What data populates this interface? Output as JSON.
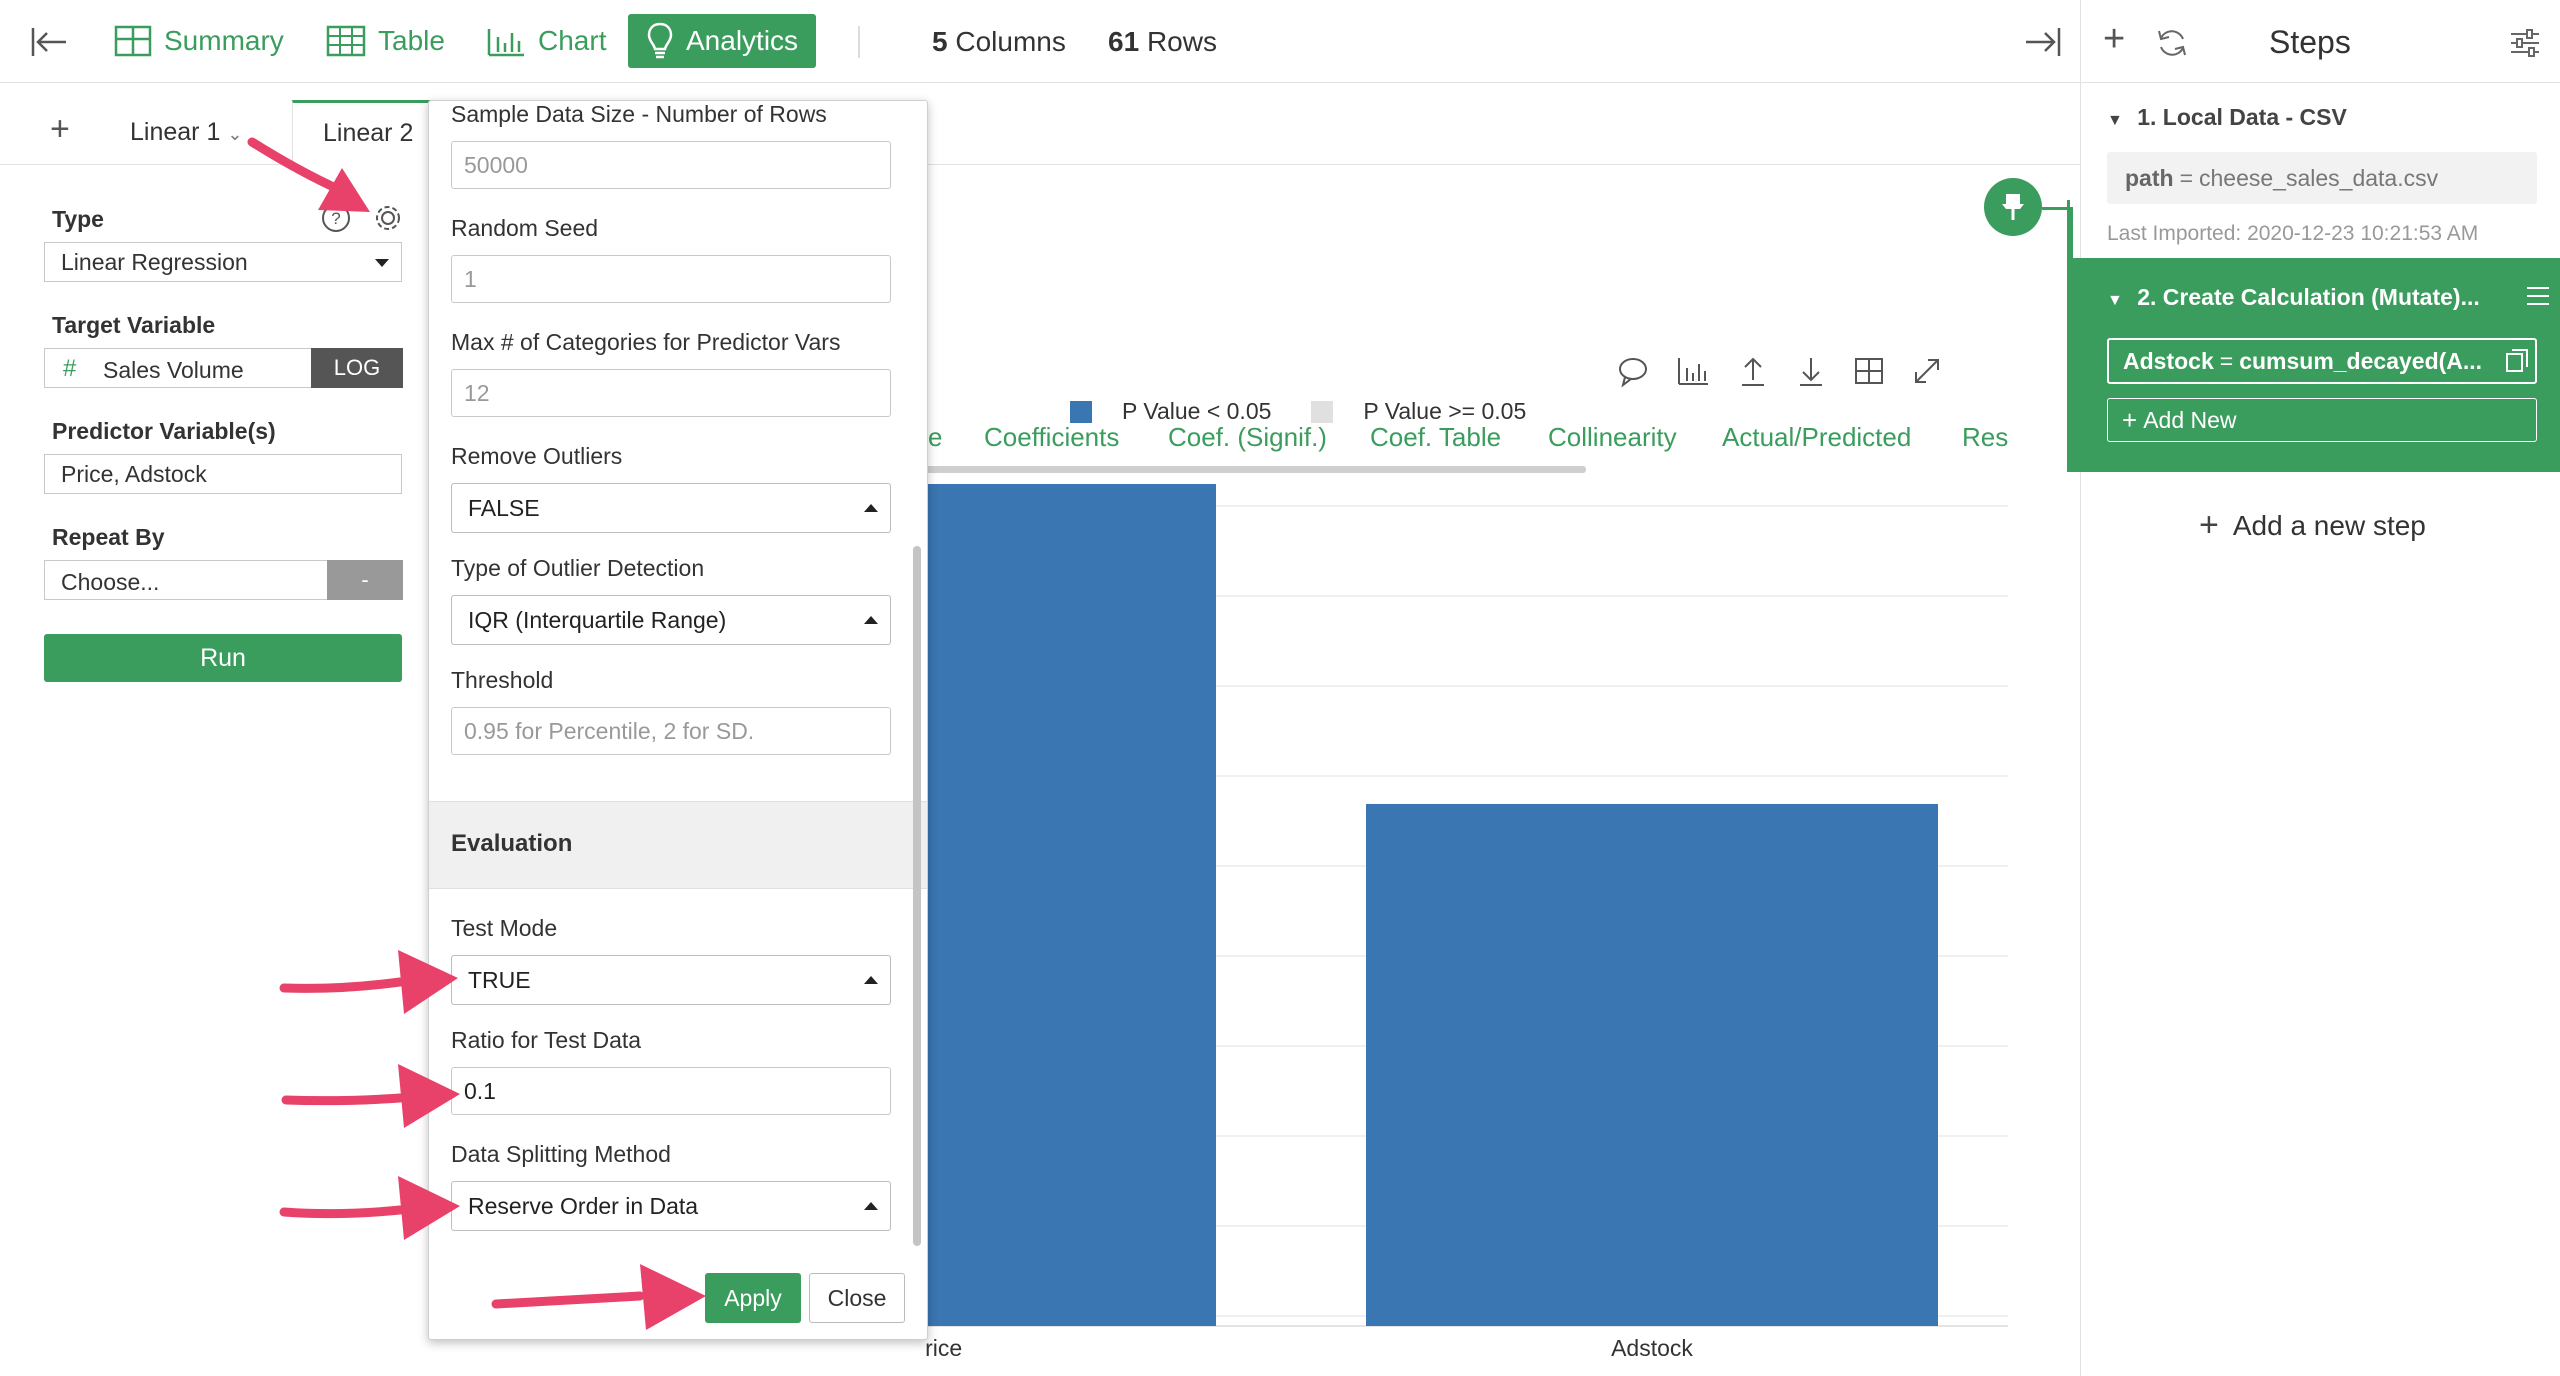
{
  "topbar": {
    "summary_label": "Summary",
    "table_label": "Table",
    "chart_label": "Chart",
    "analytics_label": "Analytics",
    "columns_count": "5",
    "columns_label": "Columns",
    "rows_count": "61",
    "rows_label": "Rows"
  },
  "tabs": {
    "add": "+",
    "items": [
      {
        "label": "Linear 1"
      },
      {
        "label": "Linear 2"
      }
    ]
  },
  "config": {
    "type_label": "Type",
    "type_value": "Linear Regression",
    "target_label": "Target Variable",
    "target_value": "Sales Volume",
    "target_badge": "LOG",
    "target_icon": "#",
    "predictor_label": "Predictor Variable(s)",
    "predictor_value": "Price, Adstock",
    "repeat_label": "Repeat By",
    "repeat_value": "Choose...",
    "repeat_badge": "-",
    "run_label": "Run"
  },
  "popup": {
    "sample_label": "Sample Data Size - Number of Rows",
    "sample_placeholder": "50000",
    "seed_label": "Random Seed",
    "seed_placeholder": "1",
    "maxcat_label": "Max # of Categories for Predictor Vars",
    "maxcat_placeholder": "12",
    "outliers_label": "Remove Outliers",
    "outliers_value": "FALSE",
    "outlier_type_label": "Type of Outlier Detection",
    "outlier_type_value": "IQR (Interquartile Range)",
    "threshold_label": "Threshold",
    "threshold_placeholder": "0.95 for Percentile, 2 for SD.",
    "evaluation_header": "Evaluation",
    "test_mode_label": "Test Mode",
    "test_mode_value": "TRUE",
    "ratio_label": "Ratio for Test Data",
    "ratio_value": "0.1",
    "split_label": "Data Splitting Method",
    "split_value": "Reserve Order in Data",
    "apply_label": "Apply",
    "close_label": "Close"
  },
  "subtabs": {
    "partial": "e",
    "items": [
      "Coefficients",
      "Coef. (Signif.)",
      "Coef. Table",
      "Collinearity",
      "Actual/Predicted",
      "Res"
    ]
  },
  "chart_data": {
    "type": "bar",
    "categories": [
      "Price",
      "Adstock"
    ],
    "legend": [
      "P Value < 0.05",
      "P Value >= 0.05"
    ],
    "legend_position": "top",
    "series_colors": [
      "#3a76b2",
      "#e0e0e0"
    ],
    "values": [
      1.0,
      0.62
    ],
    "grid": true
  },
  "steps": {
    "title": "Steps",
    "step1_title": "1. Local Data - CSV",
    "step1_key": "path",
    "step1_eq": "=",
    "step1_value": "cheese_sales_data.csv",
    "step1_meta": "Last Imported: 2020-12-23 10:21:53 AM",
    "step2_title": "2. Create Calculation (Mutate)...",
    "step2_key": "Adstock",
    "step2_eq": "=",
    "step2_value": "cumsum_decayed(A...",
    "add_new": "Add New",
    "add_step": "Add a new step"
  },
  "colors": {
    "accent": "#3a9d5d",
    "bar": "#3a76b2",
    "arrow": "#e8426a"
  }
}
